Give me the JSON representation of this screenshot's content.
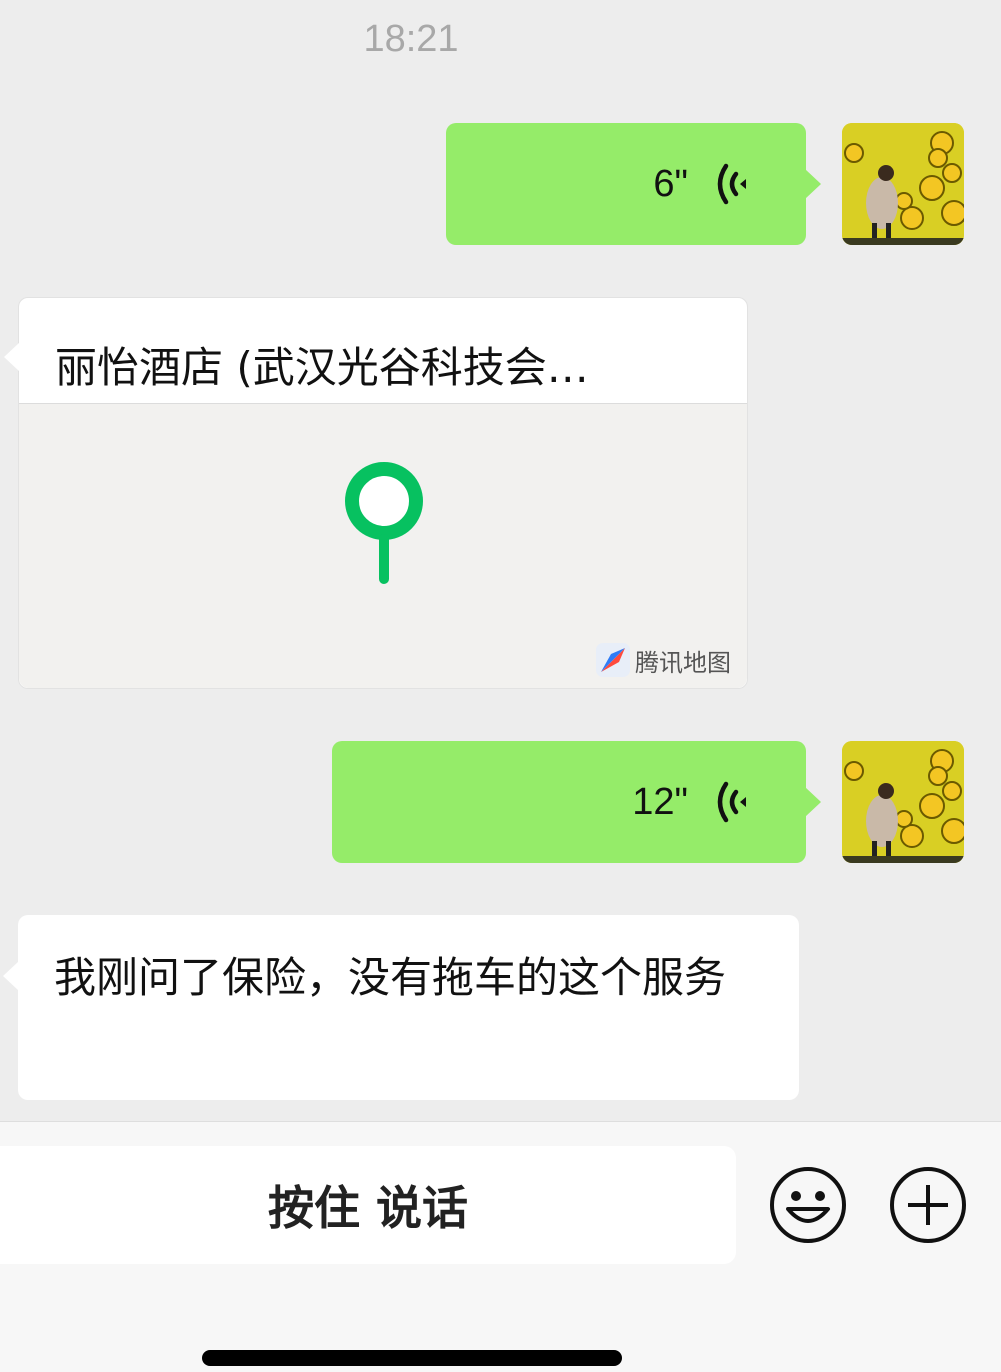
{
  "chat": {
    "timestamp": "18:21",
    "messages": [
      {
        "type": "voice",
        "side": "right",
        "duration": "6\""
      },
      {
        "type": "location",
        "side": "left",
        "title": "丽怡酒店 (武汉光谷科技会…",
        "map_provider": "腾讯地图"
      },
      {
        "type": "voice",
        "side": "right",
        "duration": "12\""
      },
      {
        "type": "text",
        "side": "left",
        "text": "我刚问了保险，没有拖车的这个服务"
      }
    ]
  },
  "input_bar": {
    "hold_to_talk_label": "按住 说话",
    "emoji_icon": "smiley-icon",
    "more_icon": "plus-circle-icon"
  },
  "colors": {
    "background": "#ededed",
    "self_bubble": "#95ec69",
    "other_bubble": "#ffffff",
    "pin": "#07c160"
  }
}
